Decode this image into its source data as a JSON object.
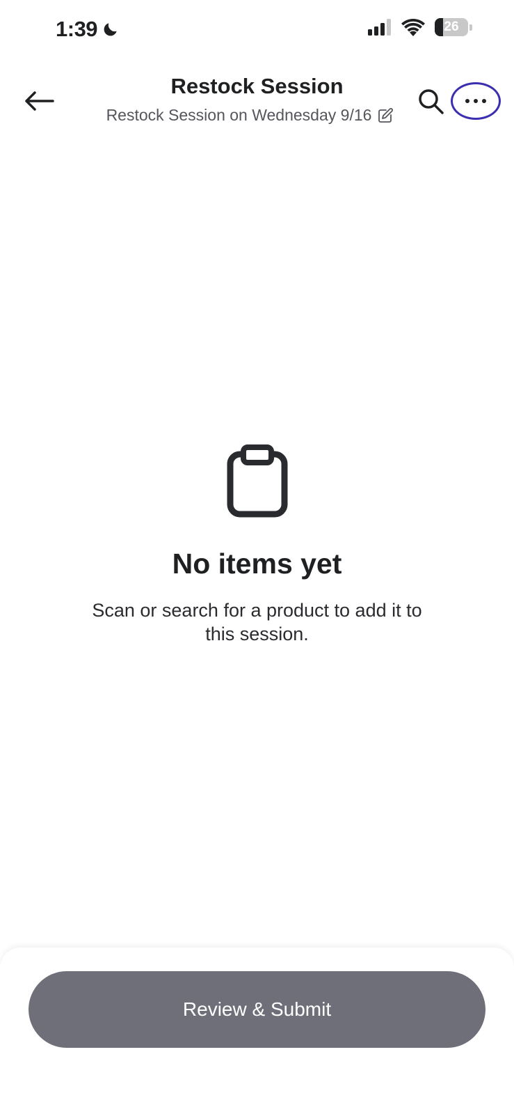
{
  "status_bar": {
    "time": "1:39",
    "battery_level": "26",
    "icons": [
      "moon-icon",
      "cellular-signal-icon",
      "wifi-icon",
      "battery-icon"
    ]
  },
  "header": {
    "title": "Restock Session",
    "subtitle": "Restock Session on Wednesday 9/16",
    "icons": [
      "back-arrow-icon",
      "edit-icon",
      "search-icon",
      "more-icon"
    ],
    "highlight_color": "#3b2fb0"
  },
  "empty_state": {
    "icon": "clipboard-icon",
    "title": "No items yet",
    "description": "Scan or search for a product to add it to this session."
  },
  "footer": {
    "submit_label": "Review & Submit",
    "submit_color": "#6e6f79"
  }
}
